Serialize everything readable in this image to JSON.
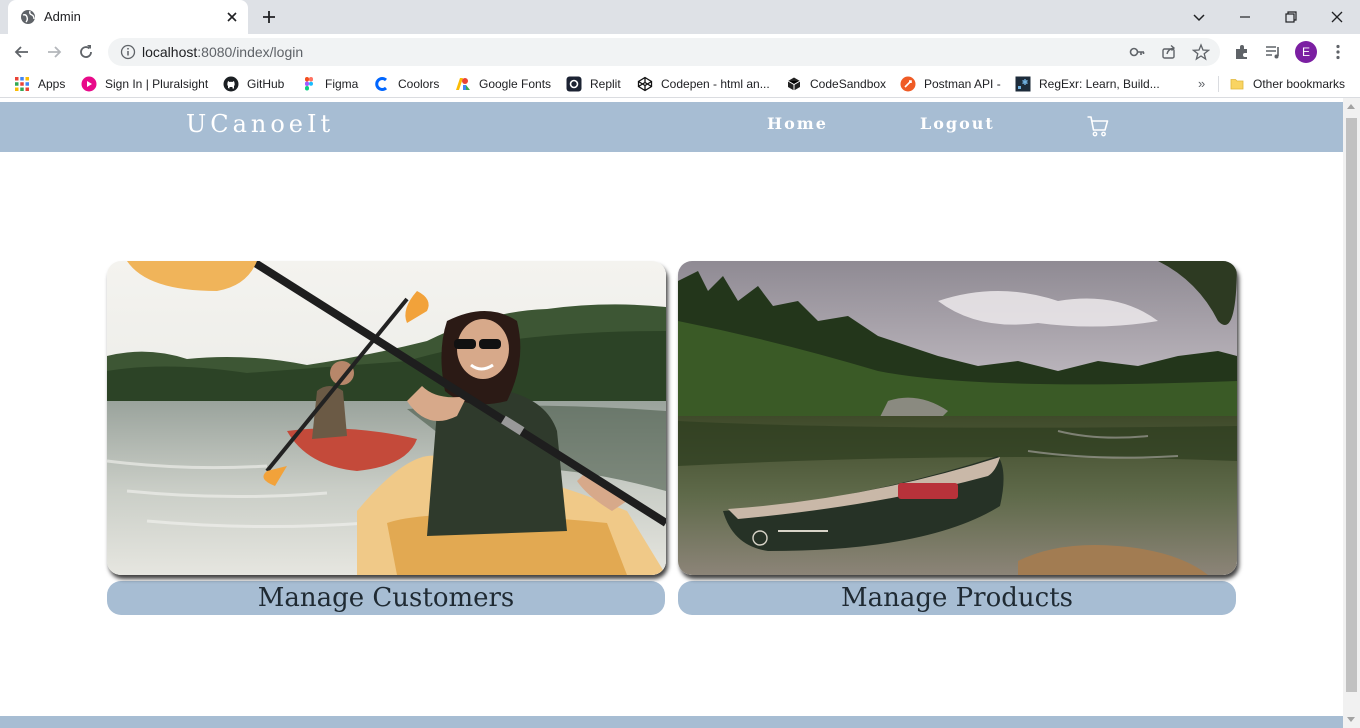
{
  "browser": {
    "tab": {
      "title": "Admin"
    },
    "url": {
      "host": "localhost",
      "rest": ":8080/index/login"
    },
    "profile_initial": "E",
    "bookmarks": [
      {
        "label": "Apps",
        "icon": "apps-grid-icon"
      },
      {
        "label": "Sign In | Pluralsight",
        "icon": "pluralsight-icon"
      },
      {
        "label": "GitHub",
        "icon": "github-icon"
      },
      {
        "label": "Figma",
        "icon": "figma-icon"
      },
      {
        "label": "Coolors",
        "icon": "coolors-icon"
      },
      {
        "label": "Google Fonts",
        "icon": "google-fonts-icon"
      },
      {
        "label": "Replit",
        "icon": "replit-icon"
      },
      {
        "label": "Codepen - html an...",
        "icon": "codepen-icon"
      },
      {
        "label": "CodeSandbox",
        "icon": "codesandbox-icon"
      },
      {
        "label": "Postman API -",
        "icon": "postman-icon"
      },
      {
        "label": "RegExr: Learn, Build...",
        "icon": "regexr-icon"
      }
    ],
    "more_bookmarks": "»",
    "other_bookmarks": "Other bookmarks"
  },
  "site": {
    "brand": "UCanoeIt",
    "nav": {
      "home": "Home",
      "logout": "Logout"
    },
    "cards": [
      {
        "label": "Manage Customers",
        "image": "couple kayaking on a lake"
      },
      {
        "label": "Manage Products",
        "image": "canoe on a forest lake"
      }
    ]
  },
  "colors": {
    "header": "#a7bdd3",
    "label_bg": "#a7bdd3",
    "profile": "#7b1fa2"
  }
}
